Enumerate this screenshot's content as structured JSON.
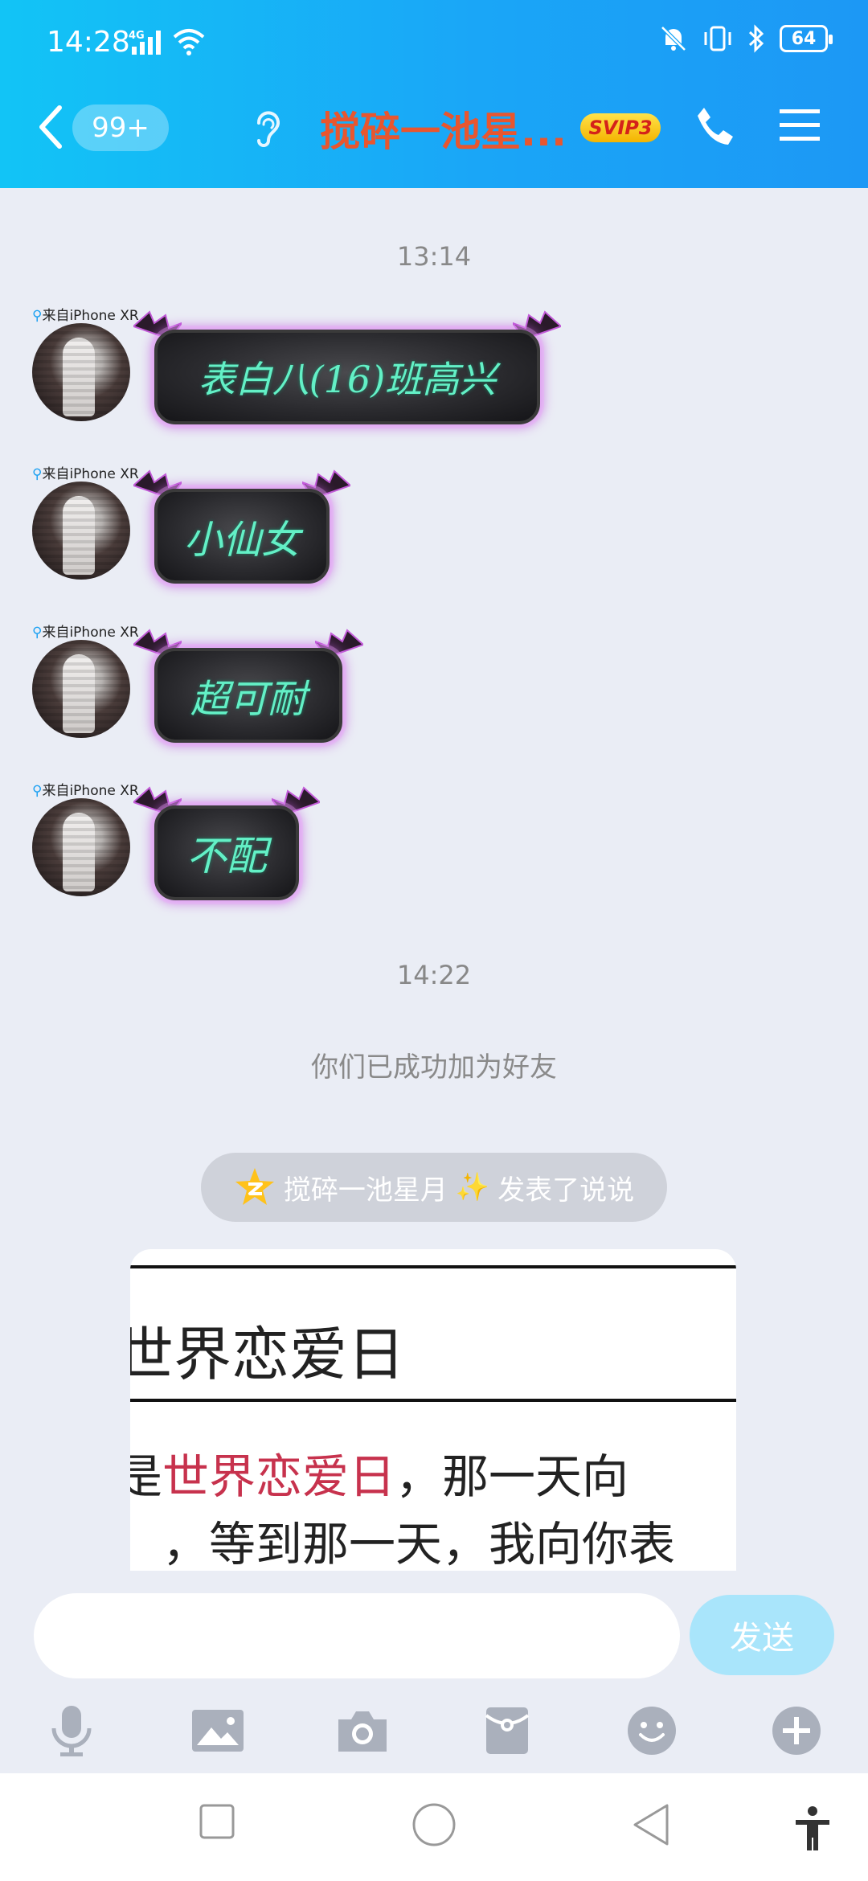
{
  "status_bar": {
    "time": "14:28",
    "network": "4G",
    "battery": "64"
  },
  "header": {
    "unread": "99+",
    "title": "搅碎一池星...",
    "vip_badge": "SVIP3"
  },
  "chat": {
    "timestamps": [
      "13:14",
      "14:22"
    ],
    "messages": [
      {
        "device": "来自iPhone XR",
        "text": "表白八(16)班高兴"
      },
      {
        "device": "来自iPhone XR",
        "text": "小仙女"
      },
      {
        "device": "来自iPhone XR",
        "text": "超可耐"
      },
      {
        "device": "来自iPhone XR",
        "text": "不配"
      }
    ],
    "system_notice": "你们已成功加为好友",
    "moment_notice": {
      "name": "搅碎一池星月",
      "sparkle": "✨",
      "action": "发表了说说"
    },
    "preview": {
      "heading": "世界恋爱日",
      "line1_prefix": "是",
      "line1_highlight": "世界恋爱日",
      "line1_suffix": "，那一天向",
      "line2": "，等到那一天，我向你表"
    }
  },
  "input": {
    "placeholder": "",
    "send_label": "发送"
  },
  "toolbar": {
    "items": [
      "microphone-icon",
      "image-icon",
      "camera-icon",
      "red-packet-icon",
      "emoji-icon",
      "plus-icon"
    ]
  },
  "colors": {
    "header_start": "#12c4f6",
    "header_end": "#1c98f5",
    "title": "#e8562f",
    "bubble_text": "#63f0c6",
    "send_button": "#a9e5fb"
  }
}
